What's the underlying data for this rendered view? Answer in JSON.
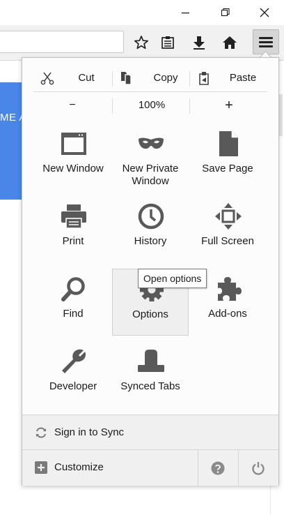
{
  "window": {
    "controls": [
      {
        "name": "minimize",
        "glyph": "—"
      },
      {
        "name": "restore",
        "glyph": "❐"
      },
      {
        "name": "close",
        "glyph": "✕"
      }
    ]
  },
  "toolbar": {
    "buttons": [
      "bookmark-star-icon",
      "reading-list-icon",
      "download-icon",
      "home-icon",
      "hamburger-menu-icon"
    ]
  },
  "page": {
    "banner_text": "ME A"
  },
  "menu": {
    "edit": {
      "cut": "Cut",
      "copy": "Copy",
      "paste": "Paste"
    },
    "zoom": {
      "out": "−",
      "level": "100%",
      "in": "+"
    },
    "items": [
      {
        "label": "New Window",
        "icon": "new-window-icon"
      },
      {
        "label": "New Private\nWindow",
        "icon": "private-mask-icon"
      },
      {
        "label": "Save Page",
        "icon": "save-page-icon"
      },
      {
        "label": "Print",
        "icon": "printer-icon"
      },
      {
        "label": "History",
        "icon": "history-clock-icon"
      },
      {
        "label": "Full Screen",
        "icon": "full-screen-icon"
      },
      {
        "label": "Find",
        "icon": "find-magnifier-icon"
      },
      {
        "label": "Options",
        "icon": "options-gear-icon"
      },
      {
        "label": "Add-ons",
        "icon": "addons-puzzle-icon"
      },
      {
        "label": "Developer",
        "icon": "developer-wrench-icon"
      },
      {
        "label": "Synced Tabs",
        "icon": "synced-tabs-icon"
      }
    ],
    "tooltip": "Open options",
    "sync_label": "Sign in to Sync",
    "customize_label": "Customize"
  },
  "colors": {
    "icon_gray": "#595959",
    "banner_blue": "#4a86e8",
    "footer_icon": "#8a8a8a"
  }
}
